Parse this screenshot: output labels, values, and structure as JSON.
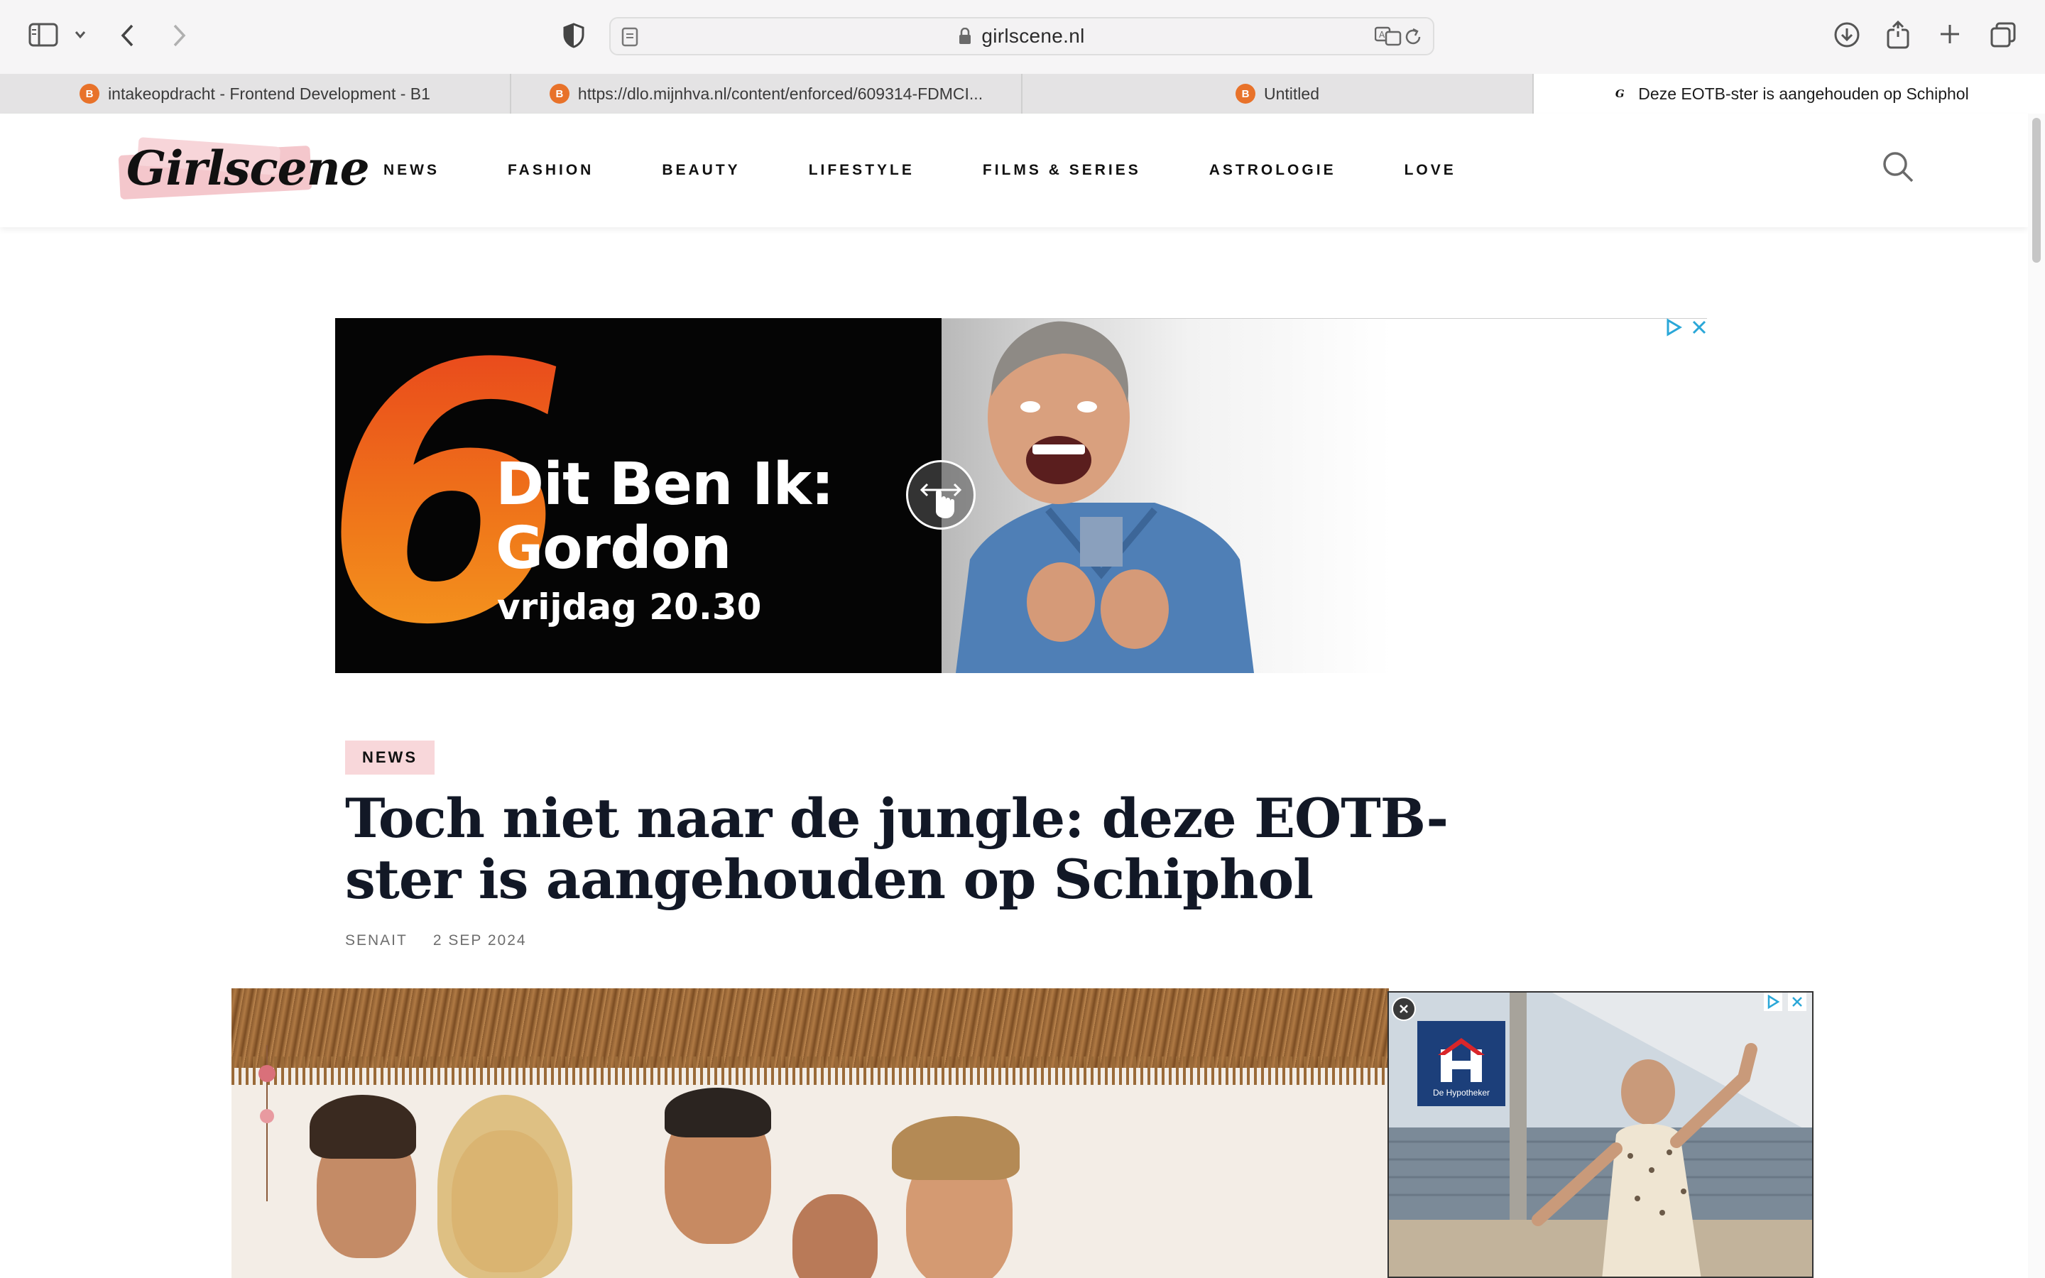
{
  "browser": {
    "url_domain": "girlscene.nl",
    "tabs": [
      {
        "label": "intakeopdracht - Frontend Development - B1",
        "favicon": "brightspace-icon",
        "active": false
      },
      {
        "label": "https://dlo.mijnhva.nl/content/enforced/609314-FDMCI...",
        "favicon": "brightspace-icon",
        "active": false
      },
      {
        "label": "Untitled",
        "favicon": "brightspace-icon",
        "active": false
      },
      {
        "label": "Deze EOTB-ster is aangehouden op Schiphol",
        "favicon": "girlscene-icon",
        "active": true
      }
    ]
  },
  "site": {
    "logo_text": "Girlscene",
    "nav": [
      "NEWS",
      "FASHION",
      "BEAUTY",
      "LIFESTYLE",
      "FILMS & SERIES",
      "ASTROLOGIE",
      "LOVE"
    ]
  },
  "ad_top": {
    "channel_number": "6",
    "title_line1": "Dit Ben Ik:",
    "title_line2": "Gordon",
    "schedule": "vrijdag 20.30"
  },
  "article": {
    "category": "NEWS",
    "title": "Toch niet naar de jungle: deze EOTB-ster is aangehouden op Schiphol",
    "author": "SENAIT",
    "date": "2 SEP 2024"
  },
  "ad_video": {
    "brand": "De Hypotheker"
  },
  "colors": {
    "accent_pink": "#f8d7da",
    "favicon_orange": "#e8722a",
    "ad_orange": "#ec5a1c",
    "hypotheker_blue": "#1c3f7a"
  }
}
